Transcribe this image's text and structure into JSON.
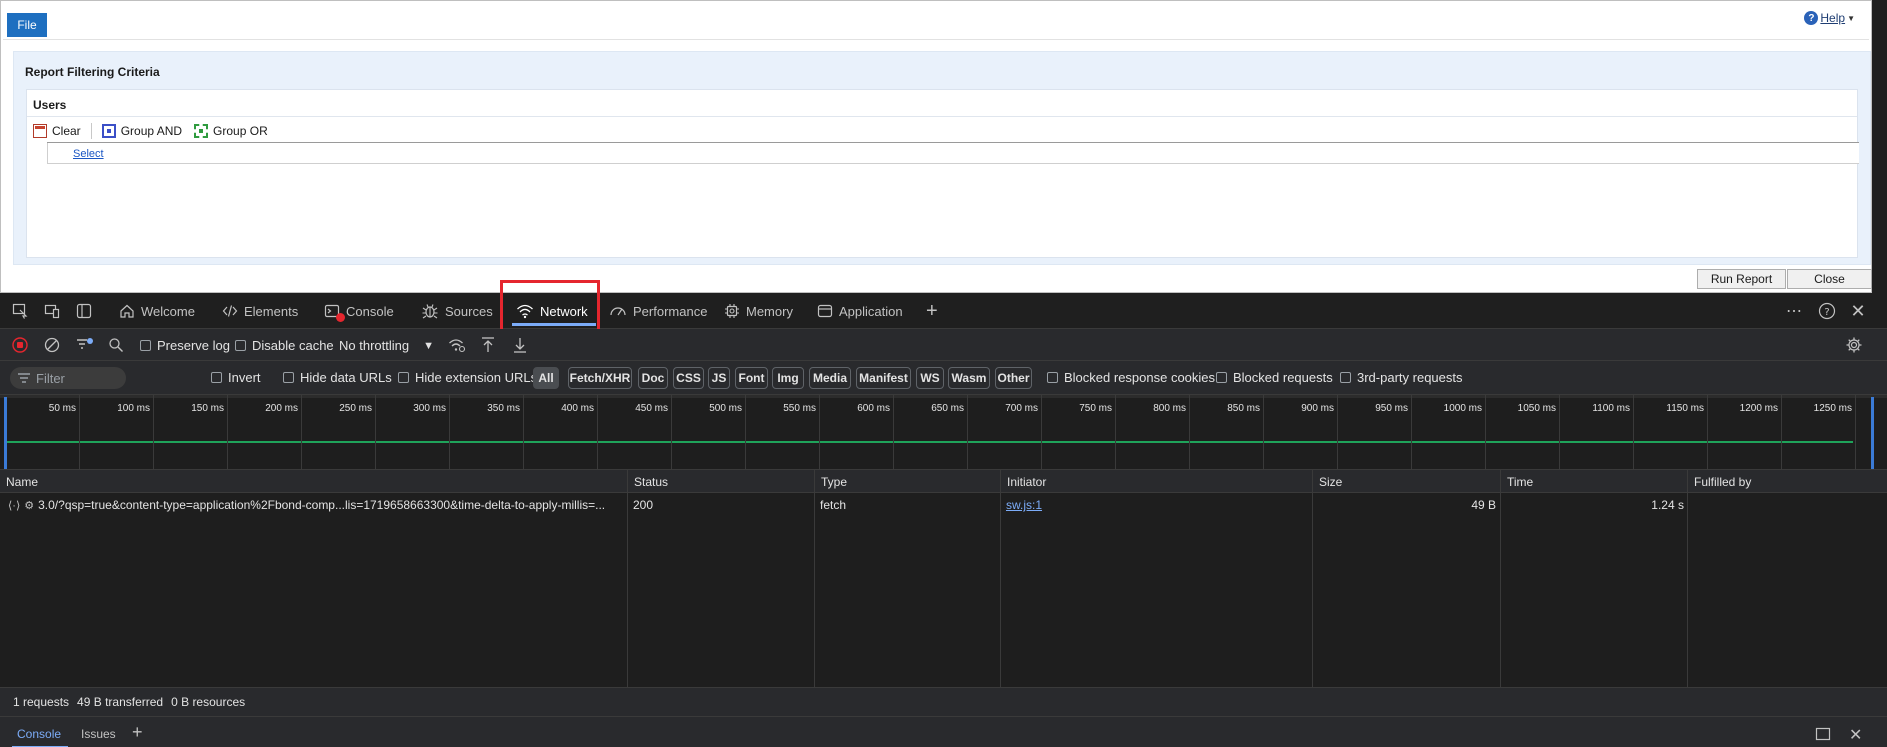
{
  "app": {
    "file_label": "File",
    "help_label": "Help",
    "criteria_title": "Report Filtering Criteria",
    "users_title": "Users",
    "toolbar": {
      "clear": "Clear",
      "group_and": "Group AND",
      "group_or": "Group OR"
    },
    "select_link": "Select",
    "run_report": "Run Report",
    "close": "Close"
  },
  "devtools": {
    "tabs": [
      "Welcome",
      "Elements",
      "Console",
      "Sources",
      "Network",
      "Performance",
      "Memory",
      "Application"
    ],
    "active_tab": "Network",
    "toolbar": {
      "preserve_log": "Preserve log",
      "disable_cache": "Disable cache",
      "throttling": "No throttling"
    },
    "filter": {
      "placeholder": "Filter",
      "invert": "Invert",
      "hide_data_urls": "Hide data URLs",
      "hide_extension_urls": "Hide extension URLs",
      "type_pills": [
        "All",
        "Fetch/XHR",
        "Doc",
        "CSS",
        "JS",
        "Font",
        "Img",
        "Media",
        "Manifest",
        "WS",
        "Wasm",
        "Other"
      ],
      "blocked_response_cookies": "Blocked response cookies",
      "blocked_requests": "Blocked requests",
      "third_party": "3rd-party requests"
    },
    "timeline_ticks": [
      "50 ms",
      "100 ms",
      "150 ms",
      "200 ms",
      "250 ms",
      "300 ms",
      "350 ms",
      "400 ms",
      "450 ms",
      "500 ms",
      "550 ms",
      "600 ms",
      "650 ms",
      "700 ms",
      "750 ms",
      "800 ms",
      "850 ms",
      "900 ms",
      "950 ms",
      "1000 ms",
      "1050 ms",
      "1100 ms",
      "1150 ms",
      "1200 ms",
      "1250 ms"
    ],
    "columns": [
      "Name",
      "Status",
      "Type",
      "Initiator",
      "Size",
      "Time",
      "Fulfilled by"
    ],
    "rows": [
      {
        "name": "3.0/?qsp=true&content-type=application%2Fbond-comp...lis=1719658663300&time-delta-to-apply-millis=...",
        "status": "200",
        "type": "fetch",
        "initiator": "sw.js:1",
        "size": "49 B",
        "time": "1.24 s",
        "fulfilled_by": ""
      }
    ],
    "summary": {
      "requests": "1 requests",
      "transferred": "49 B transferred",
      "resources": "0 B resources"
    },
    "drawer_tabs": [
      "Console",
      "Issues"
    ]
  }
}
